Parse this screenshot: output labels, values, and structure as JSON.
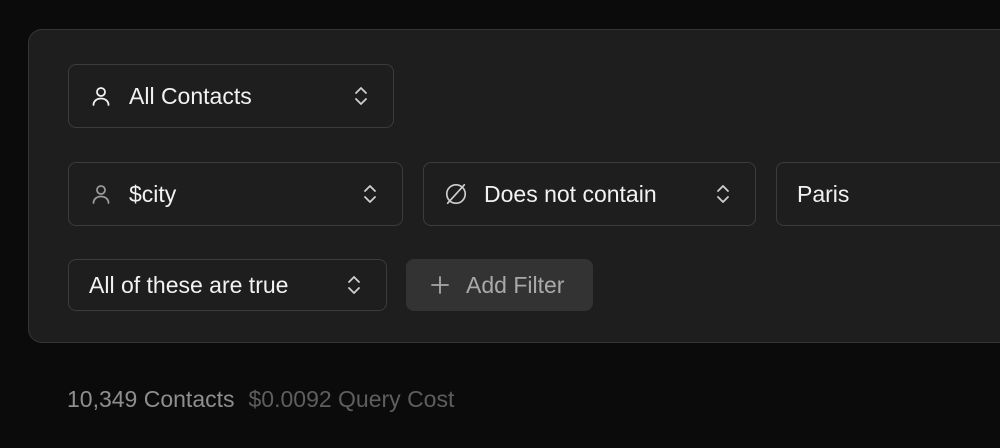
{
  "audience_select": {
    "icon": "person-icon",
    "label": "All Contacts"
  },
  "filter": {
    "property": {
      "icon": "person-icon",
      "label": "$city"
    },
    "operator": {
      "icon": "empty-set-icon",
      "label": "Does not contain"
    },
    "value": "Paris"
  },
  "logic_select": {
    "label": "All of these are true"
  },
  "add_filter_button": {
    "icon": "plus-icon",
    "label": "Add Filter"
  },
  "summary": {
    "contacts": "10,349 Contacts",
    "query_cost": "$0.0092 Query Cost"
  }
}
